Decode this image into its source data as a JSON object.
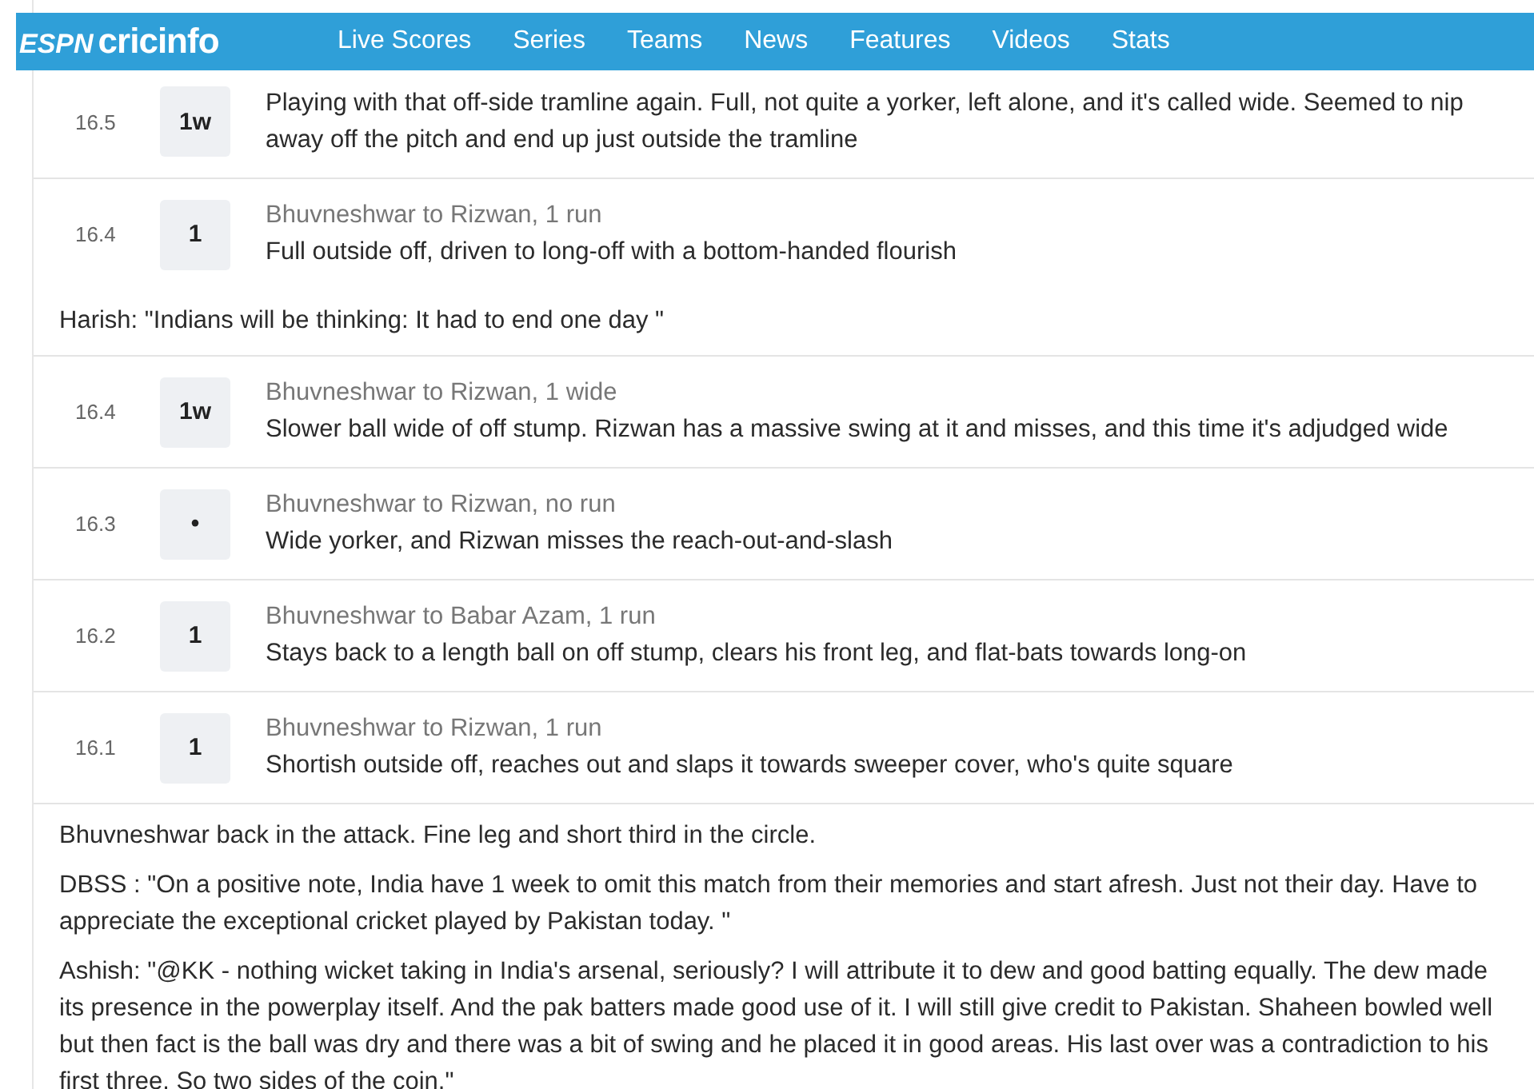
{
  "nav": {
    "brand": [
      "ESPN",
      "cricinfo"
    ],
    "items": [
      "Live Scores",
      "Series",
      "Teams",
      "News",
      "Features",
      "Videos",
      "Stats"
    ]
  },
  "commentary": [
    {
      "kind": "ball",
      "over": "16.5",
      "result": "1w",
      "text": "Playing with that off-side tramline again. Full, not quite a yorker, left alone, and it's called wide. Seemed to nip away off the pitch and end up just outside the tramline"
    },
    {
      "kind": "ball",
      "over": "16.4",
      "result": "1",
      "title": "Bhuvneshwar to Rizwan, 1 run",
      "text": "Full outside off, driven to long-off with a bottom-handed flourish"
    },
    {
      "kind": "note",
      "text": "Harish: \"Indians will be thinking: It had to end one day \""
    },
    {
      "kind": "ball",
      "over": "16.4",
      "result": "1w",
      "title": "Bhuvneshwar to Rizwan, 1 wide",
      "text": "Slower ball wide of off stump. Rizwan has a massive swing at it and misses, and this time it's adjudged wide"
    },
    {
      "kind": "ball",
      "over": "16.3",
      "result": "•",
      "title": "Bhuvneshwar to Rizwan, no run",
      "text": "Wide yorker, and Rizwan misses the reach-out-and-slash"
    },
    {
      "kind": "ball",
      "over": "16.2",
      "result": "1",
      "title": "Bhuvneshwar to Babar Azam, 1 run",
      "text": "Stays back to a length ball on off stump, clears his front leg, and flat-bats towards long-on"
    },
    {
      "kind": "ball",
      "over": "16.1",
      "result": "1",
      "title": "Bhuvneshwar to Rizwan, 1 run",
      "text": "Shortish outside off, reaches out and slaps it towards sweeper cover, who's quite square"
    },
    {
      "kind": "note",
      "text": "Bhuvneshwar back in the attack. Fine leg and short third in the circle."
    },
    {
      "kind": "note",
      "text": "DBSS : \"On a positive note, India have 1 week to omit this match from their memories and start afresh. Just not their day. Have to appreciate the exceptional cricket played by Pakistan today. \""
    },
    {
      "kind": "note",
      "text": "Ashish: \"@KK - nothing wicket taking in India's arsenal, seriously? I will attribute it to dew and good batting equally. The dew made its presence in the powerplay itself. And the pak batters made good use of it. I will still give credit to Pakistan. Shaheen bowled well but then fact is the ball was dry and there was a bit of swing and he placed it in good areas. His last over was a contradiction to his first three. So two sides of the coin.\""
    }
  ]
}
